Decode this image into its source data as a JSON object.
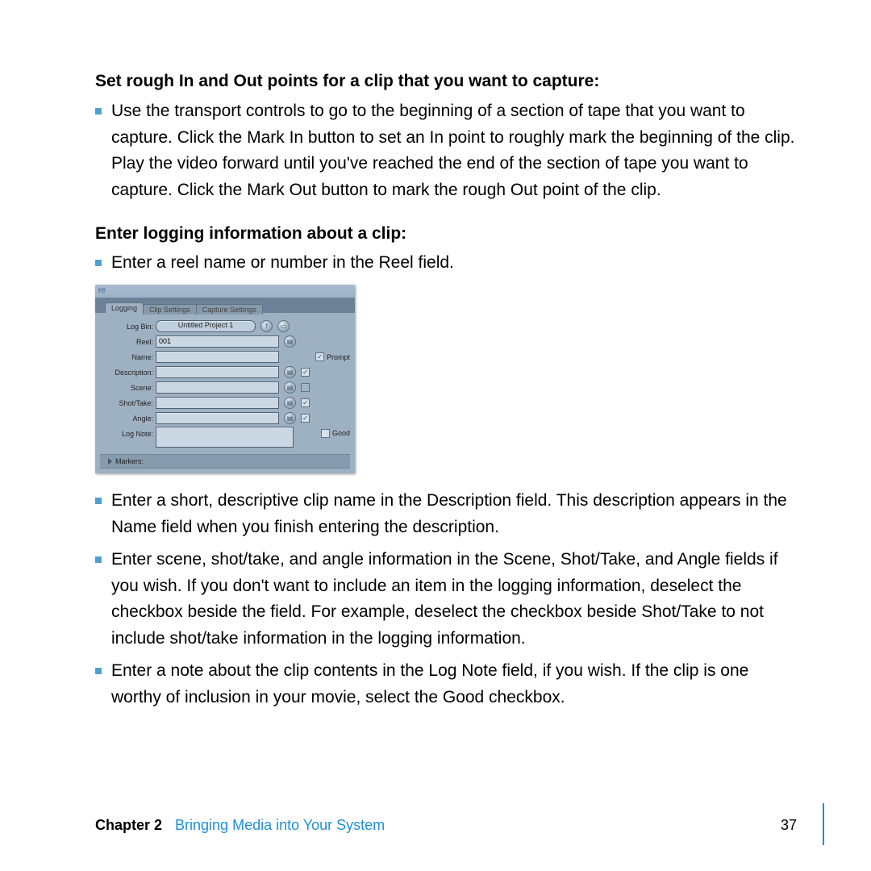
{
  "heading1": "Set rough In and Out points for a clip that you want to capture:",
  "bullet1": "Use the transport controls to go to the beginning of a section of tape that you want to capture. Click the Mark In button to set an In point to roughly mark the beginning of the clip. Play the video forward until you've reached the end of the section of tape you want to capture. Click the Mark Out button to mark the rough Out point of the clip.",
  "heading2": "Enter logging information about a clip:",
  "bullet2": "Enter a reel name or number in the Reel field.",
  "panel": {
    "window_fragment": "re",
    "tabs": {
      "active": "Logging",
      "t2": "Clip Settings",
      "t3": "Capture Settings"
    },
    "labels": {
      "log_bin": "Log Bin:",
      "reel": "Reel:",
      "name": "Name:",
      "description": "Description:",
      "scene": "Scene:",
      "shot_take": "Shot/Take:",
      "angle": "Angle:",
      "log_note": "Log Note:",
      "markers": "Markers:"
    },
    "values": {
      "log_bin": "Untitled Project 1",
      "reel": "001"
    },
    "prompt_label": "Prompt",
    "good_label": "Good"
  },
  "bullets_after": [
    "Enter a short, descriptive clip name in the Description field. This description appears in the Name field when you finish entering the description.",
    "Enter scene, shot/take, and angle information in the Scene, Shot/Take, and Angle fields if you wish. If you don't want to include an item in the logging information, deselect the checkbox beside the field. For example, deselect the checkbox beside Shot/Take to not include shot/take information in the logging information.",
    "Enter a note about the clip contents in the Log Note field, if you wish. If the clip is one worthy of inclusion in your movie, select the Good checkbox."
  ],
  "footer": {
    "chapter": "Chapter 2",
    "title": "Bringing Media into Your System",
    "page": "37"
  }
}
